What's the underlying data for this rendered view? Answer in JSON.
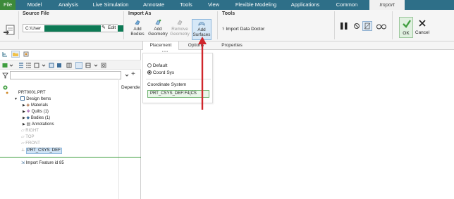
{
  "tabs": [
    {
      "label": "File",
      "style": "file"
    },
    {
      "label": "Model"
    },
    {
      "label": "Analysis"
    },
    {
      "label": "Live Simulation"
    },
    {
      "label": "Annotate"
    },
    {
      "label": "Tools"
    },
    {
      "label": "View"
    },
    {
      "label": "Flexible Modeling"
    },
    {
      "label": "Applications"
    },
    {
      "label": "Common"
    },
    {
      "label": "Import",
      "style": "active"
    }
  ],
  "source_file": {
    "title": "Source File",
    "path_prefix": "C:\\User",
    "edit_label": "Edit"
  },
  "import_as": {
    "title": "Import As",
    "add_bodies": "Add\nBodies",
    "add_geometry": "Add\nGeometry",
    "remove_geometry": "Remove\nGeometry",
    "add_surfaces": "Add\nSurfaces"
  },
  "tools": {
    "title": "Tools",
    "import_data_doctor": "Import Data Doctor"
  },
  "actions": {
    "ok": "OK",
    "cancel": "Cancel"
  },
  "subtabs": {
    "placement": "Placement",
    "options": "Options",
    "properties": "Properties",
    "handle": "• • •"
  },
  "placement_panel": {
    "option_default": "Default",
    "option_coord_sys": "Coord Sys",
    "selected": "Coord Sys",
    "coord_system_label": "Coordinate System",
    "coord_system_value": "PRT_CSYS_DEF:F4(CS"
  },
  "tree": {
    "column_header": "Depende",
    "root": "PRT0001.PRT",
    "design_items": "Design Items",
    "materials": "Materials",
    "quilts": "Quilts (1)",
    "bodies": "Bodies (1)",
    "annotations": "Annotations",
    "right": "RIGHT",
    "top": "TOP",
    "front": "FRONT",
    "csys": "PRT_CSYS_DEF",
    "import_feature": "Import Feature id 85"
  },
  "colors": {
    "tabbar": "#2e6f88",
    "file_tab": "#3d8a3a",
    "ok_green": "#3f9e3f",
    "arrow_red": "#d0262b",
    "redaction": "#0d7a55"
  }
}
